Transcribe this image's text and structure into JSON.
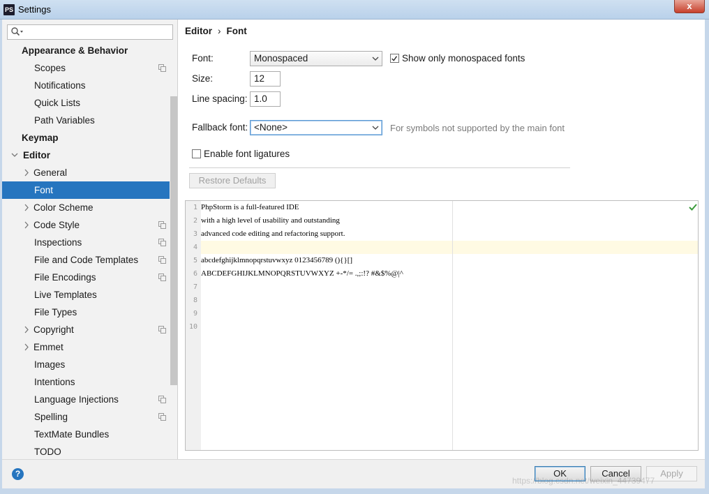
{
  "window": {
    "icon_text": "PS",
    "title": "Settings",
    "close_glyph": "x"
  },
  "search": {
    "value": "",
    "placeholder": ""
  },
  "sidebar": {
    "items": [
      {
        "label": "Appearance & Behavior",
        "level": 0,
        "bold": true
      },
      {
        "label": "Scopes",
        "level": 1,
        "project_icon": true
      },
      {
        "label": "Notifications",
        "level": 1
      },
      {
        "label": "Quick Lists",
        "level": 1
      },
      {
        "label": "Path Variables",
        "level": 1
      },
      {
        "label": "Keymap",
        "level": 0,
        "bold": true
      },
      {
        "label": "Editor",
        "level": 0,
        "bold": true,
        "expanded": true
      },
      {
        "label": "General",
        "level": 1,
        "collapsed": true
      },
      {
        "label": "Font",
        "level": 1,
        "selected": true
      },
      {
        "label": "Color Scheme",
        "level": 1,
        "collapsed": true
      },
      {
        "label": "Code Style",
        "level": 1,
        "collapsed": true,
        "project_icon": true
      },
      {
        "label": "Inspections",
        "level": 1,
        "project_icon": true
      },
      {
        "label": "File and Code Templates",
        "level": 1,
        "project_icon": true
      },
      {
        "label": "File Encodings",
        "level": 1,
        "project_icon": true
      },
      {
        "label": "Live Templates",
        "level": 1
      },
      {
        "label": "File Types",
        "level": 1
      },
      {
        "label": "Copyright",
        "level": 1,
        "collapsed": true,
        "project_icon": true
      },
      {
        "label": "Emmet",
        "level": 1,
        "collapsed": true
      },
      {
        "label": "Images",
        "level": 1
      },
      {
        "label": "Intentions",
        "level": 1
      },
      {
        "label": "Language Injections",
        "level": 1,
        "project_icon": true
      },
      {
        "label": "Spelling",
        "level": 1,
        "project_icon": true
      },
      {
        "label": "TextMate Bundles",
        "level": 1
      },
      {
        "label": "TODO",
        "level": 1
      }
    ]
  },
  "breadcrumb": {
    "parent": "Editor",
    "separator": "›",
    "current": "Font"
  },
  "form": {
    "font_label": "Font:",
    "font_value": "Monospaced",
    "show_mono_label": "Show only monospaced fonts",
    "show_mono_checked": true,
    "size_label": "Size:",
    "size_value": "12",
    "line_spacing_label": "Line spacing:",
    "line_spacing_value": "1.0",
    "fallback_label": "Fallback font:",
    "fallback_value": "<None>",
    "fallback_hint": "For symbols not supported by the main font",
    "ligatures_label": "Enable font ligatures",
    "ligatures_checked": false,
    "restore_label": "Restore Defaults"
  },
  "preview": {
    "lines": [
      {
        "n": "1",
        "text": "PhpStorm is a full-featured IDE"
      },
      {
        "n": "2",
        "text": "with a high level of usability and outstanding"
      },
      {
        "n": "3",
        "text": "advanced code editing and refactoring support."
      },
      {
        "n": "4",
        "text": ""
      },
      {
        "n": "5",
        "text": "abcdefghijklmnopqrstuvwxyz 0123456789 (){}[]"
      },
      {
        "n": "6",
        "text": "ABCDEFGHIJKLMNOPQRSTUVWXYZ +-*/= .,;:!? #&$%@|^"
      },
      {
        "n": "7",
        "text": ""
      },
      {
        "n": "8",
        "text": ""
      },
      {
        "n": "9",
        "text": ""
      },
      {
        "n": "10",
        "text": ""
      }
    ]
  },
  "footer": {
    "help_glyph": "?",
    "ok_label": "OK",
    "cancel_label": "Cancel",
    "apply_label": "Apply"
  },
  "watermark": "https://blog.csdn.net/weixin_44739477",
  "colors": {
    "selection": "#2675bf",
    "caret_line": "#fffae3",
    "sidebar_bg": "#f2f2f2"
  }
}
